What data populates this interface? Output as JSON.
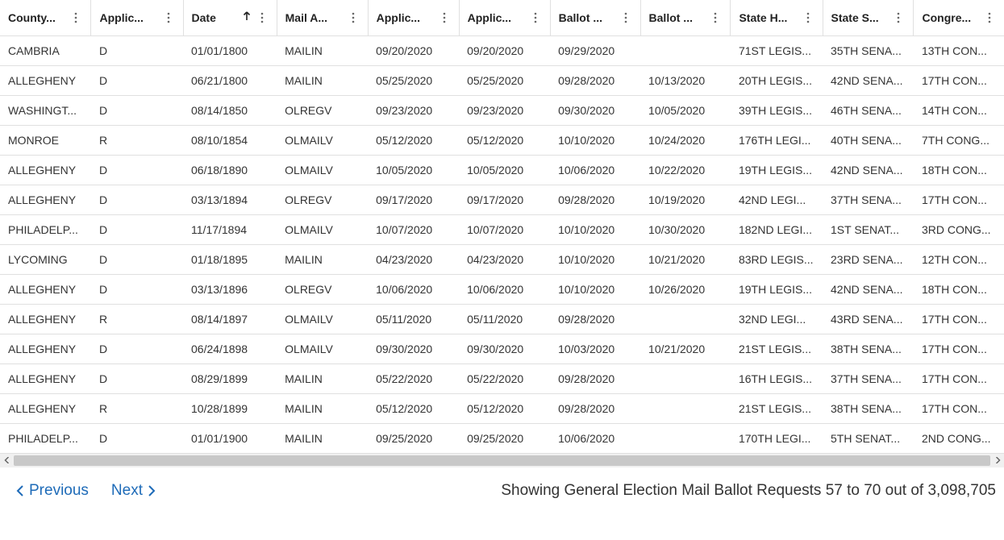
{
  "columns": [
    {
      "label": "County...",
      "sort": null
    },
    {
      "label": "Applic...",
      "sort": null
    },
    {
      "label": "Date",
      "sort": "asc"
    },
    {
      "label": "Mail A...",
      "sort": null
    },
    {
      "label": "Applic...",
      "sort": null
    },
    {
      "label": "Applic...",
      "sort": null
    },
    {
      "label": "Ballot ...",
      "sort": null
    },
    {
      "label": "Ballot ...",
      "sort": null
    },
    {
      "label": "State H...",
      "sort": null
    },
    {
      "label": "State S...",
      "sort": null
    },
    {
      "label": "Congre...",
      "sort": null
    }
  ],
  "rows": [
    [
      "CAMBRIA",
      "D",
      "01/01/1800",
      "MAILIN",
      "09/20/2020",
      "09/20/2020",
      "09/29/2020",
      "",
      "71ST LEGIS...",
      "35TH SENA...",
      "13TH CON..."
    ],
    [
      "ALLEGHENY",
      "D",
      "06/21/1800",
      "MAILIN",
      "05/25/2020",
      "05/25/2020",
      "09/28/2020",
      "10/13/2020",
      "20TH LEGIS...",
      "42ND SENA...",
      "17TH CON..."
    ],
    [
      "WASHINGT...",
      "D",
      "08/14/1850",
      "OLREGV",
      "09/23/2020",
      "09/23/2020",
      "09/30/2020",
      "10/05/2020",
      "39TH LEGIS...",
      "46TH SENA...",
      "14TH CON..."
    ],
    [
      "MONROE",
      "R",
      "08/10/1854",
      "OLMAILV",
      "05/12/2020",
      "05/12/2020",
      "10/10/2020",
      "10/24/2020",
      "176TH LEGI...",
      "40TH SENA...",
      "7TH CONG..."
    ],
    [
      "ALLEGHENY",
      "D",
      "06/18/1890",
      "OLMAILV",
      "10/05/2020",
      "10/05/2020",
      "10/06/2020",
      "10/22/2020",
      "19TH LEGIS...",
      "42ND SENA...",
      "18TH CON..."
    ],
    [
      "ALLEGHENY",
      "D",
      "03/13/1894",
      "OLREGV",
      "09/17/2020",
      "09/17/2020",
      "09/28/2020",
      "10/19/2020",
      "42ND LEGI...",
      "37TH SENA...",
      "17TH CON..."
    ],
    [
      "PHILADELP...",
      "D",
      "11/17/1894",
      "OLMAILV",
      "10/07/2020",
      "10/07/2020",
      "10/10/2020",
      "10/30/2020",
      "182ND LEGI...",
      "1ST SENAT...",
      "3RD CONG..."
    ],
    [
      "LYCOMING",
      "D",
      "01/18/1895",
      "MAILIN",
      "04/23/2020",
      "04/23/2020",
      "10/10/2020",
      "10/21/2020",
      "83RD LEGIS...",
      "23RD SENA...",
      "12TH CON..."
    ],
    [
      "ALLEGHENY",
      "D",
      "03/13/1896",
      "OLREGV",
      "10/06/2020",
      "10/06/2020",
      "10/10/2020",
      "10/26/2020",
      "19TH LEGIS...",
      "42ND SENA...",
      "18TH CON..."
    ],
    [
      "ALLEGHENY",
      "R",
      "08/14/1897",
      "OLMAILV",
      "05/11/2020",
      "05/11/2020",
      "09/28/2020",
      "",
      "32ND LEGI...",
      "43RD SENA...",
      "17TH CON..."
    ],
    [
      "ALLEGHENY",
      "D",
      "06/24/1898",
      "OLMAILV",
      "09/30/2020",
      "09/30/2020",
      "10/03/2020",
      "10/21/2020",
      "21ST LEGIS...",
      "38TH SENA...",
      "17TH CON..."
    ],
    [
      "ALLEGHENY",
      "D",
      "08/29/1899",
      "MAILIN",
      "05/22/2020",
      "05/22/2020",
      "09/28/2020",
      "",
      "16TH LEGIS...",
      "37TH SENA...",
      "17TH CON..."
    ],
    [
      "ALLEGHENY",
      "R",
      "10/28/1899",
      "MAILIN",
      "05/12/2020",
      "05/12/2020",
      "09/28/2020",
      "",
      "21ST LEGIS...",
      "38TH SENA...",
      "17TH CON..."
    ],
    [
      "PHILADELP...",
      "D",
      "01/01/1900",
      "MAILIN",
      "09/25/2020",
      "09/25/2020",
      "10/06/2020",
      "",
      "170TH LEGI...",
      "5TH SENAT...",
      "2ND CONG..."
    ]
  ],
  "pager": {
    "previous": "Previous",
    "next": "Next"
  },
  "status": "Showing General Election Mail Ballot Requests 57 to 70 out of 3,098,705"
}
